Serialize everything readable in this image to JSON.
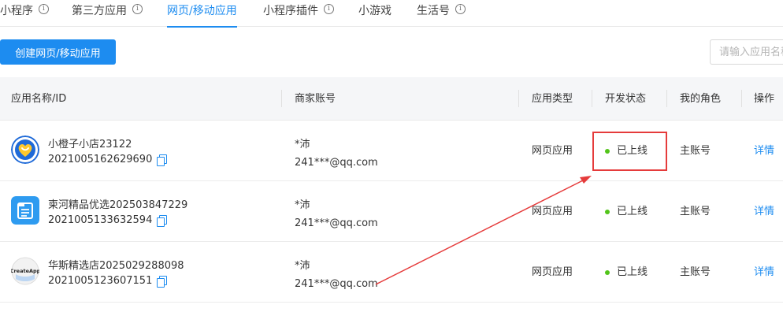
{
  "tabs": [
    {
      "label": "小程序",
      "info": "i"
    },
    {
      "label": "第三方应用",
      "info": "i"
    },
    {
      "label": "网页/移动应用",
      "info": ""
    },
    {
      "label": "小程序插件",
      "info": "i"
    },
    {
      "label": "小游戏",
      "info": ""
    },
    {
      "label": "生活号",
      "info": "i"
    }
  ],
  "active_tab": "网页/移动应用",
  "create_button": "创建网页/移动应用",
  "search": {
    "placeholder": "请输入应用名称",
    "value": ""
  },
  "table": {
    "headers": [
      "应用名称/ID",
      "商家账号",
      "应用类型",
      "开发状态",
      "我的角色",
      "操作"
    ],
    "rows": [
      {
        "name": "小橙子小店23122",
        "id": "2021005162629690",
        "merchant_name": "*沛",
        "merchant_email": "241***@qq.com",
        "type": "网页应用",
        "status": "已上线",
        "role": "主账号",
        "action": "详情",
        "icon": "heart-logo-icon"
      },
      {
        "name": "柬河精品优选202503847229",
        "id": "2021005133632594",
        "merchant_name": "*沛",
        "merchant_email": "241***@qq.com",
        "type": "网页应用",
        "status": "已上线",
        "role": "主账号",
        "action": "详情",
        "icon": "folder-list-icon"
      },
      {
        "name": "华斯精选店2025029288098",
        "id": "2021005123607151",
        "merchant_name": "*沛",
        "merchant_email": "241***@qq.com",
        "type": "网页应用",
        "status": "已上线",
        "role": "主账号",
        "action": "详情",
        "icon": "createapp-logo-icon"
      }
    ]
  },
  "app_logo_text": "CreateApp",
  "colors": {
    "accent": "#1d8cf0",
    "status_online": "#52c41a",
    "annotation": "#e53b3b",
    "header_bg": "#f5f6f8"
  }
}
